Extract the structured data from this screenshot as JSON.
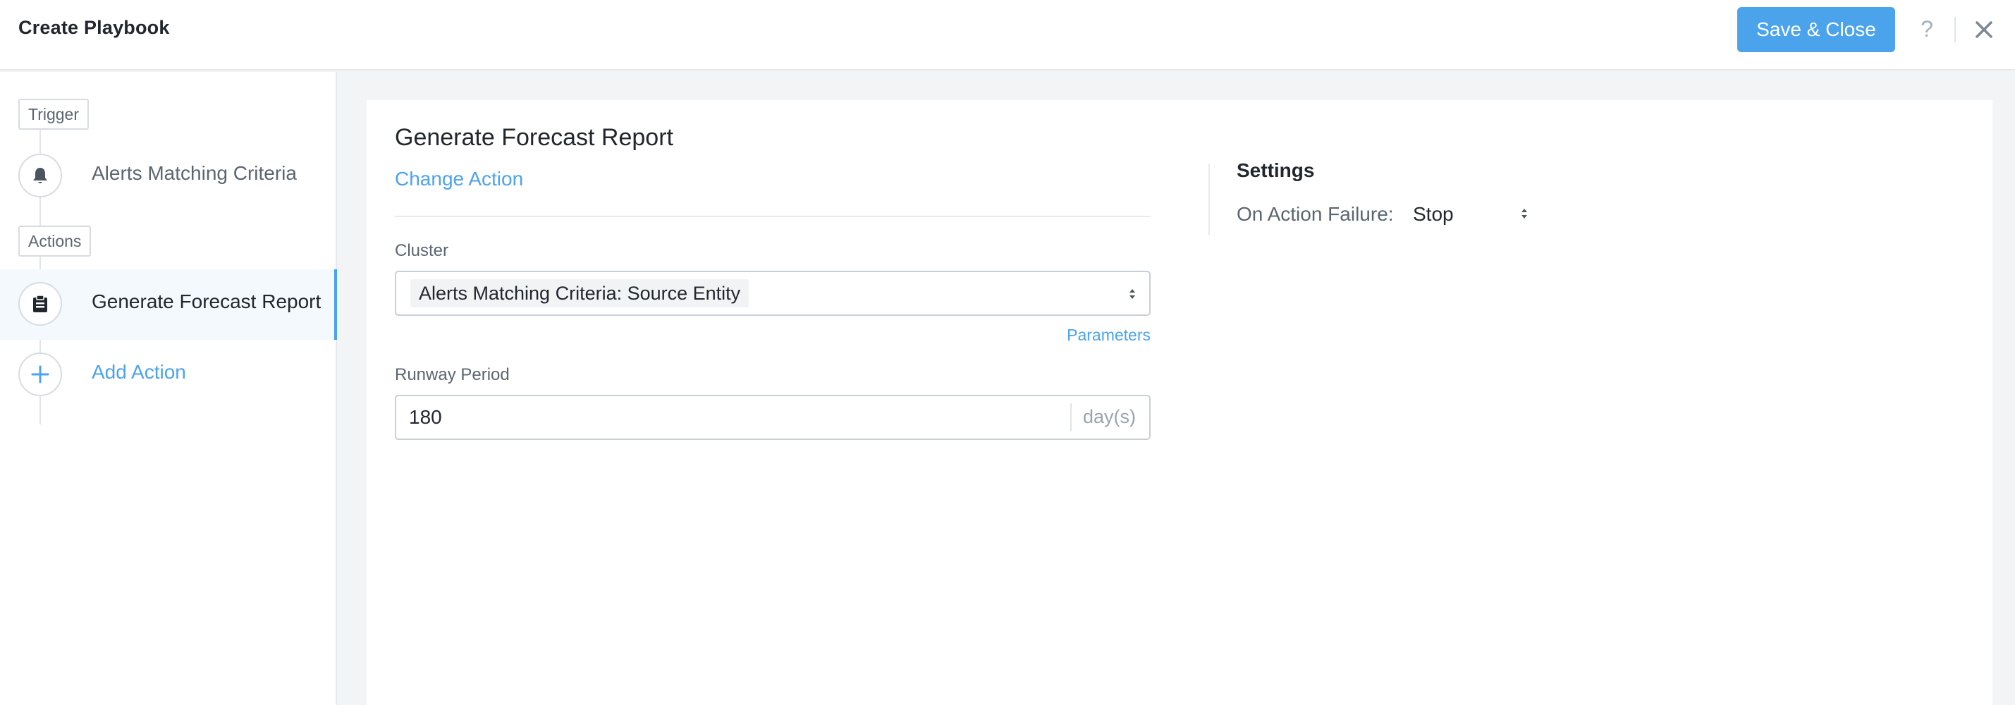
{
  "header": {
    "title": "Create Playbook",
    "save_label": "Save & Close",
    "help_symbol": "?"
  },
  "sidebar": {
    "trigger_tag": "Trigger",
    "actions_tag": "Actions",
    "steps": [
      {
        "label": "Alerts Matching Criteria",
        "icon": "bell-icon",
        "active": false
      },
      {
        "label": "Generate Forecast Report",
        "icon": "clipboard-icon",
        "active": true
      },
      {
        "label": "Add Action",
        "icon": "plus-icon",
        "active": false
      }
    ]
  },
  "main": {
    "action_title": "Generate Forecast Report",
    "change_action_label": "Change Action",
    "cluster": {
      "label": "Cluster",
      "value": "Alerts Matching Criteria: Source Entity"
    },
    "parameters_label": "Parameters",
    "runway": {
      "label": "Runway Period",
      "value": "180",
      "unit": "day(s)"
    },
    "settings": {
      "title": "Settings",
      "failure_label": "On Action Failure:",
      "failure_value": "Stop"
    }
  },
  "colors": {
    "accent": "#4ba3ec",
    "text": "#22272e",
    "muted": "#5b6570",
    "background": "#f2f4f6"
  }
}
